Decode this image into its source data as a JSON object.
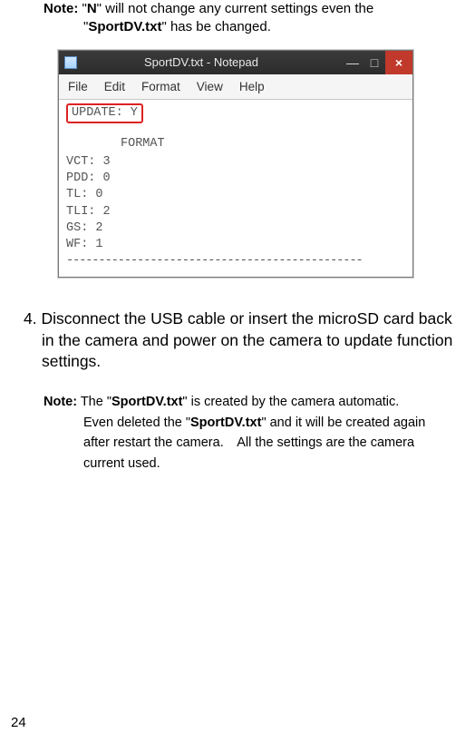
{
  "note1": {
    "label": "Note:",
    "q1": "\"",
    "n": "N",
    "mid": "\" will not change any current settings even the",
    "q2": "\"",
    "file": "SportDV.txt",
    "tail": "\" has be changed."
  },
  "notepad": {
    "title": "SportDV.txt - Notepad",
    "minimize": "—",
    "maximize": "□",
    "close": "×",
    "menu": {
      "file": "File",
      "edit": "Edit",
      "format": "Format",
      "view": "View",
      "help": "Help"
    },
    "content": {
      "update": "UPDATE: Y",
      "format": "FORMAT",
      "vct": "VCT: 3",
      "pdd": "PDD: 0",
      "tl": "TL: 0",
      "tli": "TLI: 2",
      "gs": "GS: 2",
      "wf": "WF: 1",
      "divider": "----------------------------------------------"
    }
  },
  "step4_text": "4. Disconnect the USB cable or insert the microSD card back in the camera and power on the camera to update function settings.",
  "note2": {
    "label": "Note:",
    "p1a": " The \"",
    "file1": "SportDV.txt",
    "p1b": "\" is created by the camera automatic.",
    "p2a": "Even deleted the \"",
    "file2": "SportDV.txt",
    "p2b": "\" and it will be created again",
    "p3": "after restart the camera. All the settings are the camera",
    "p4": "current used."
  },
  "page": "24"
}
